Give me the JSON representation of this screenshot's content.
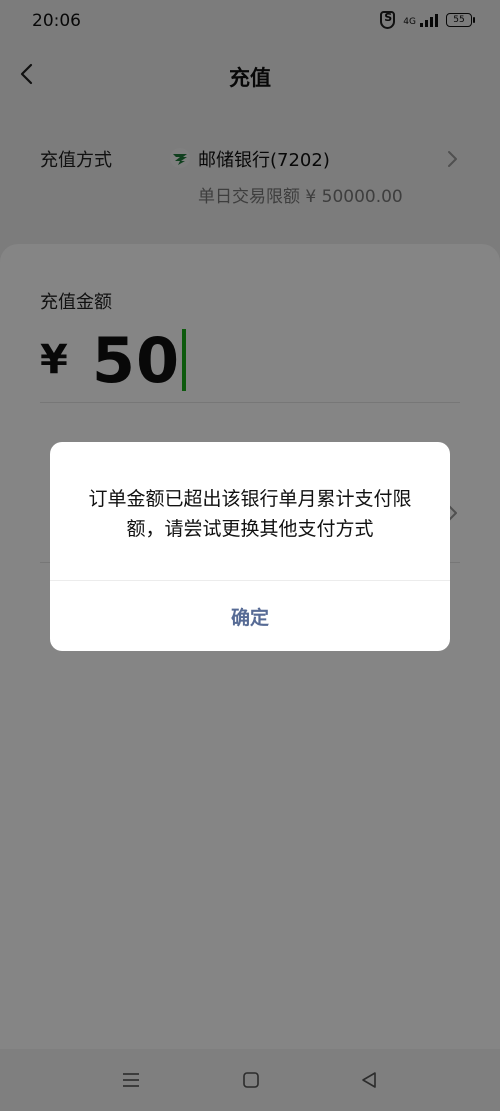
{
  "status_bar": {
    "time": "20:06",
    "network": "4G",
    "battery": "55"
  },
  "nav": {
    "title": "充值"
  },
  "payment_method": {
    "label": "充值方式",
    "bank_name": "邮储银行(7202)",
    "daily_limit": "单日交易限额 ¥ 50000.00"
  },
  "amount": {
    "label": "充值金额",
    "currency_symbol": "¥",
    "value": "50"
  },
  "dialog": {
    "message": "订单金额已超出该银行单月累计支付限额，请尝试更换其他支付方式",
    "confirm_label": "确定",
    "accent_color": "#576b95"
  },
  "icons": {
    "back": "back-chevron-icon",
    "bank": "postal-bank-logo",
    "next": "chevron-right-icon",
    "menu": "menu-icon",
    "home": "home-icon",
    "sys_back": "back-triangle-icon"
  }
}
